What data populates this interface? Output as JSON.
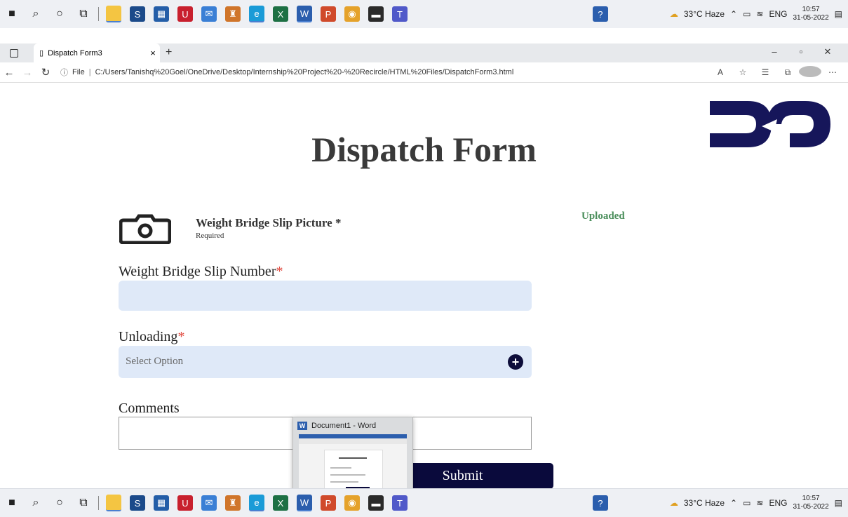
{
  "taskbar": {
    "weather": "33°C Haze",
    "language": "ENG",
    "time": "10:57",
    "date": "31-05-2022"
  },
  "browser": {
    "tab_title": "Dispatch Form3",
    "tab_close": "×",
    "new_tab": "+",
    "url_prefix": "File",
    "url": "C:/Users/Tanishq%20Goel/OneDrive/Desktop/Internship%20Project%20-%20Recircle/HTML%20Files/DispatchForm3.html"
  },
  "form": {
    "title": "Dispatch Form",
    "slip_picture_label": "Weight Bridge Slip Picture *",
    "slip_picture_sub": "Required",
    "uploaded_status": "Uploaded",
    "slip_number_label": "Weight Bridge Slip Number",
    "unloading_label": "Unloading",
    "unloading_placeholder": "Select Option",
    "comments_label": "Comments",
    "submit_label": "Submit",
    "required_marker": "*"
  },
  "preview": {
    "title": "Document1 - Word"
  }
}
